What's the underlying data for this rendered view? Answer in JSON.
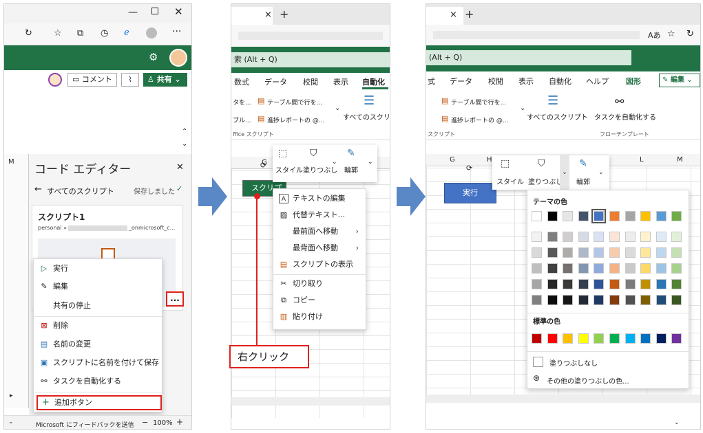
{
  "panel1": {
    "edge_tools": [
      "⚙"
    ],
    "comment_button": "コメント",
    "share_button": "共有",
    "editor": {
      "title": "コード エディター",
      "back_link": "すべてのスクリプト",
      "saved_status": "保存しました",
      "script_name": "スクリプト1",
      "script_owner_prefix": "personal »",
      "script_owner_suffix": "_onmicrosoft_c..."
    },
    "menu": [
      {
        "label": "実行",
        "icon": "play-icon"
      },
      {
        "label": "編集",
        "icon": "pencil-icon"
      },
      {
        "label": "共有の停止",
        "icon": ""
      },
      {
        "label": "削除",
        "icon": "delete-icon"
      },
      {
        "label": "名前の変更",
        "icon": "rename-icon"
      },
      {
        "label": "スクリプトに名前を付けて保存",
        "icon": "save-as-icon"
      },
      {
        "label": "タスクを自動化する",
        "icon": "flow-icon"
      },
      {
        "label": "追加ボタン",
        "icon": "plus-icon"
      }
    ],
    "more_button": "...",
    "footer_feedback": "Microsoft にフィードバックを送信",
    "zoom_minus": "−",
    "zoom_level": "100%",
    "zoom_plus": "+",
    "col_letter": "M"
  },
  "panel2": {
    "tab_close": "×",
    "tab_new": "+",
    "search_text": "索 (Alt + Q)",
    "ribbon_tabs": [
      "数式",
      "データ",
      "校閲",
      "表示",
      "自動化"
    ],
    "gallery_items": [
      "タを...",
      "テーブル間で行を...",
      "ブル...",
      "進捗レポートの @..."
    ],
    "all_scripts": "すべてのスクリプ",
    "group_label": "ffice スクリプト",
    "col_letter": "G",
    "shape_label": "スクリプ",
    "mini_toolbar": [
      "スタイル",
      "塗りつぶし",
      "輪郭"
    ],
    "context_menu": [
      {
        "label": "テキストの編集",
        "icon": "text-edit-icon",
        "arrow": ""
      },
      {
        "label": "代替テキスト...",
        "icon": "alt-text-icon",
        "arrow": ""
      },
      {
        "label": "最前面へ移動",
        "icon": "",
        "arrow": "›"
      },
      {
        "label": "最背面へ移動",
        "icon": "",
        "arrow": "›"
      },
      {
        "label": "スクリプトの表示",
        "icon": "script-icon",
        "arrow": ""
      },
      {
        "label": "切り取り",
        "icon": "scissors-icon",
        "arrow": ""
      },
      {
        "label": "コピー",
        "icon": "copy-icon",
        "arrow": ""
      },
      {
        "label": "貼り付け",
        "icon": "paste-icon",
        "arrow": ""
      }
    ],
    "callout": "右クリック"
  },
  "panel3": {
    "tab_close": "×",
    "tab_new": "+",
    "search_text": "(Alt + Q)",
    "ribbon_tabs": [
      "式",
      "データ",
      "校閲",
      "表示",
      "自動化",
      "ヘルプ",
      "図形"
    ],
    "edit_button": "編集",
    "gallery_items": [
      "テーブル間で行を...",
      "進捗レポートの @..."
    ],
    "all_scripts": "すべてのスクリプト",
    "automate_task": "タスクを自動化する",
    "group_label_1": "スクリプト",
    "group_label_2": "フローテンプレート",
    "col_letters": [
      "G",
      "H",
      "L",
      "M"
    ],
    "shape_label": "実行",
    "mini_toolbar": [
      "スタイル",
      "塗りつぶし",
      "輪郭"
    ],
    "theme_colors_label": "テーマの色",
    "standard_colors_label": "標準の色",
    "no_fill": "塗りつぶしなし",
    "more_fill_colors": "その他の塗りつぶしの色...",
    "theme_base": [
      "#ffffff",
      "#000000",
      "#e7e6e6",
      "#44546a",
      "#4472c4",
      "#ed7d31",
      "#a5a5a5",
      "#ffc000",
      "#5b9bd5",
      "#70ad47"
    ],
    "theme_shades": [
      [
        "#f2f2f2",
        "#7f7f7f",
        "#d0cece",
        "#d6dce5",
        "#d9e2f3",
        "#fbe5d6",
        "#ededed",
        "#fff2cc",
        "#deebf7",
        "#e2f0d9"
      ],
      [
        "#d9d9d9",
        "#595959",
        "#aeabab",
        "#adb9ca",
        "#b4c7e7",
        "#f8cbad",
        "#dbdbdb",
        "#ffe699",
        "#bdd7ee",
        "#c5e0b4"
      ],
      [
        "#bfbfbf",
        "#404040",
        "#767171",
        "#8497b0",
        "#8faadc",
        "#f4b183",
        "#c9c9c9",
        "#ffd966",
        "#9dc3e6",
        "#a9d18e"
      ],
      [
        "#a6a6a6",
        "#262626",
        "#3b3838",
        "#333f50",
        "#2f5597",
        "#c55a11",
        "#7b7b7b",
        "#bf9000",
        "#2e75b6",
        "#548235"
      ],
      [
        "#7f7f7f",
        "#0d0d0d",
        "#171616",
        "#222a35",
        "#1f3864",
        "#843c0c",
        "#525252",
        "#7f6000",
        "#1f4e79",
        "#385723"
      ]
    ],
    "standard": [
      "#c00000",
      "#ff0000",
      "#ffc000",
      "#ffff00",
      "#92d050",
      "#00b050",
      "#00b0f0",
      "#0070c0",
      "#002060",
      "#7030a0"
    ]
  },
  "colors": {
    "excel_green": "#217346",
    "shape_blue": "#4472c4",
    "shape_green": "#1e7145",
    "highlight_red": "#e0201c",
    "arrow_blue": "#5a87c5"
  }
}
